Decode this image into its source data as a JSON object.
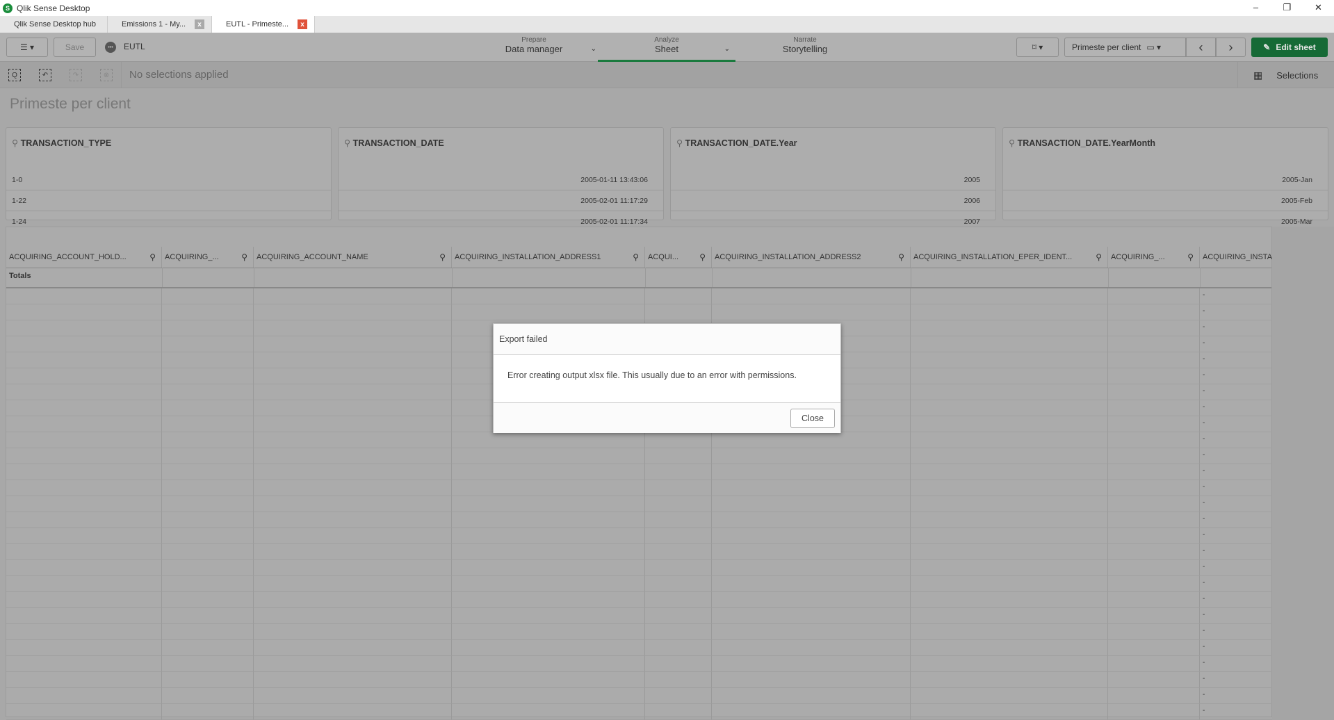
{
  "window": {
    "title": "Qlik Sense Desktop",
    "logo": "S",
    "min": "–",
    "max": "❐",
    "close": "✕"
  },
  "tabs": [
    {
      "label": "Qlik Sense Desktop hub"
    },
    {
      "label": "Emissions 1 - My...",
      "close": "x"
    },
    {
      "label": "EUTL - Primeste...",
      "close": "x"
    }
  ],
  "toolbar": {
    "menu": "☰ ▾",
    "save": "Save",
    "app_name": "EUTL",
    "app_icon": "•••",
    "nav": [
      {
        "sub": "Prepare",
        "label": "Data manager"
      },
      {
        "sub": "Analyze",
        "label": "Sheet"
      },
      {
        "sub": "Narrate",
        "label": "Storytelling"
      }
    ],
    "bookmark": "⌑ ▾",
    "sheet_selector": "Primeste per client",
    "sheet_icon": "▭ ▾",
    "prev": "‹",
    "next": "›",
    "edit_sheet": "Edit sheet",
    "edit_icon": "✎"
  },
  "selections_bar": {
    "status": "No selections applied",
    "selections_label": "Selections"
  },
  "sheet": {
    "title": "Primeste per client"
  },
  "filters": [
    {
      "title": "TRANSACTION_TYPE",
      "values": [
        "1-0",
        "1-22",
        "1-24"
      ],
      "align": "left"
    },
    {
      "title": "TRANSACTION_DATE",
      "values": [
        "2005-01-11 13:43:06",
        "2005-02-01 11:17:29",
        "2005-02-01 11:17:34"
      ],
      "align": "right"
    },
    {
      "title": "TRANSACTION_DATE.Year",
      "values": [
        "2005",
        "2006",
        "2007"
      ],
      "align": "right"
    },
    {
      "title": "TRANSACTION_DATE.YearMonth",
      "values": [
        "2005-Jan",
        "2005-Feb",
        "2005-Mar"
      ],
      "align": "right"
    }
  ],
  "table": {
    "columns": [
      "ACQUIRING_ACCOUNT_HOLD...",
      "ACQUIRING_...",
      "ACQUIRING_ACCOUNT_NAME",
      "ACQUIRING_INSTALLATION_ADDRESS1",
      "ACQUI...",
      "ACQUIRING_INSTALLATION_ADDRESS2",
      "ACQUIRING_INSTALLATION_EPER_IDENT...",
      "ACQUIRING_...",
      "ACQUIRING_INSTA"
    ],
    "totals_label": "Totals",
    "last_col_value": "-",
    "row_count": 27
  },
  "dialog": {
    "title": "Export failed",
    "message": "Error creating output xlsx file. This usually due to an error with permissions.",
    "close": "Close"
  }
}
